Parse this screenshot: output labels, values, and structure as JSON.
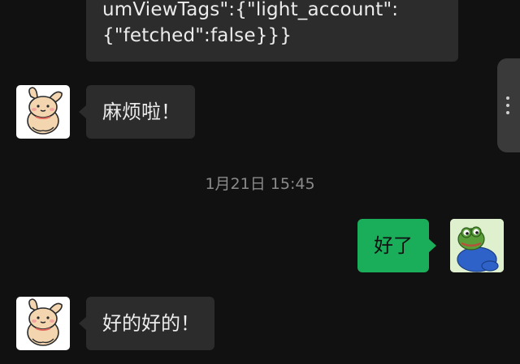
{
  "chat": {
    "top_message_text": "umViewTags\":{\"light_account\":\n{\"fetched\":false}}}",
    "message_1_text": "麻烦啦！",
    "timestamp": "1月21日 15:45",
    "message_2_text": "好了",
    "message_3_text": "好的好的！"
  },
  "colors": {
    "background": "#111111",
    "incoming_bubble": "#2c2c2c",
    "outgoing_bubble": "#1aad5a",
    "timestamp_text": "#8a8a8a"
  },
  "icons": {
    "contact_avatar": "bunny-avatar-icon",
    "self_avatar": "frog-avatar-icon",
    "scroll_handle": "more-dots-icon"
  }
}
